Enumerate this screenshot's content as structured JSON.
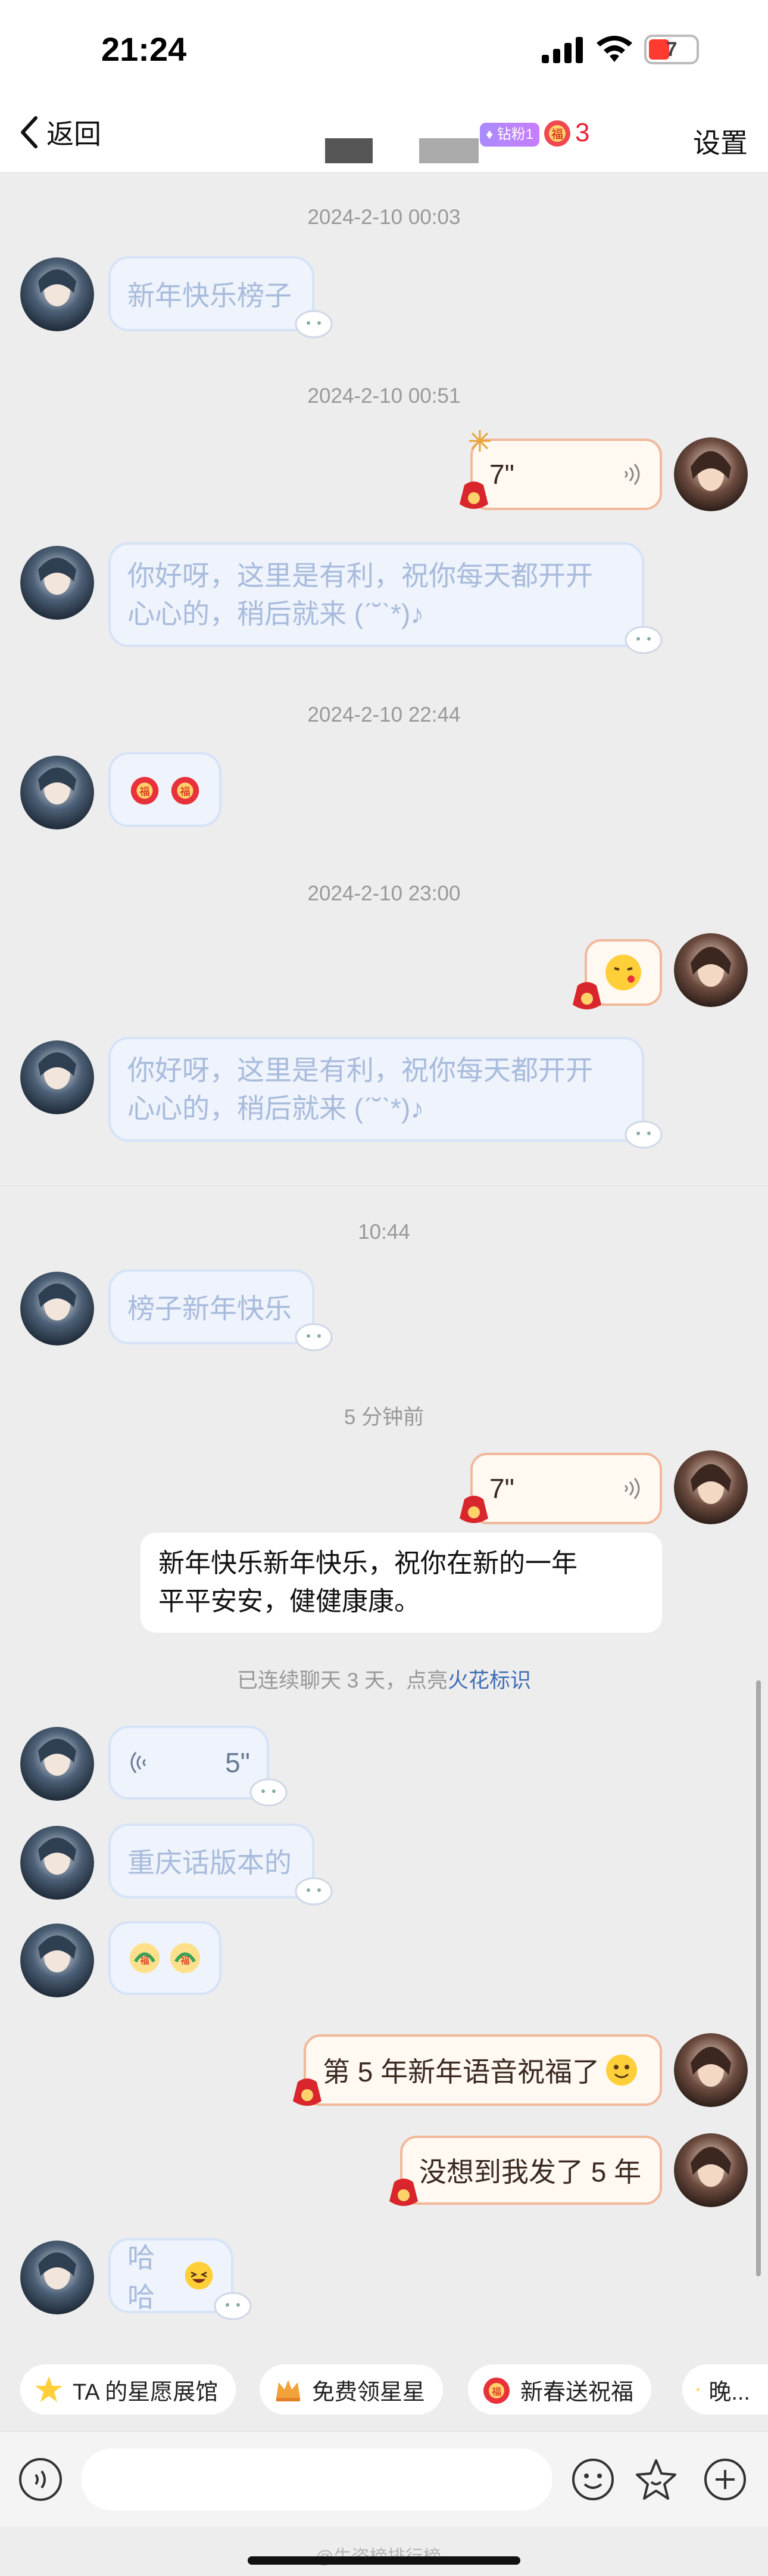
{
  "status_bar": {
    "time": "21:24",
    "battery_level": "7"
  },
  "nav": {
    "back_label": "返回",
    "badge_label": "钻粉1",
    "fire_count": "3",
    "settings_label": "设置"
  },
  "timestamps": {
    "t1": "2024-2-10 00:03",
    "t2": "2024-2-10 00:51",
    "t3": "2024-2-10 22:44",
    "t4": "2024-2-10 23:00",
    "t5": "10:44",
    "t6": "5 分钟前"
  },
  "messages": {
    "m1": "新年快乐榜子",
    "m2_voice": "7\"",
    "m3_line1": "你好呀，这里是有利，祝你每天都开开",
    "m3_line2": "心心的，稍后就来 (ˊ˘ˋ*)♪",
    "m6_line1": "你好呀，这里是有利，祝你每天都开开",
    "m6_line2": "心心的，稍后就来 (ˊ˘ˋ*)♪",
    "m7": "榜子新年快乐",
    "m8_voice": "7\"",
    "m8_transcript_line1": "新年快乐新年快乐，祝你在新的一年",
    "m8_transcript_line2": "平平安安，健健康康。",
    "m9_voice": "5\"",
    "m10": "重庆话版本的",
    "m12": "第 5 年新年语音祝福了",
    "m13": "没想到我发了 5 年",
    "m14": "哈哈"
  },
  "streak": {
    "prefix": "已连续聊天 3 天，点亮",
    "link": "火花标识"
  },
  "chips": [
    {
      "label": "TA 的星愿展馆",
      "icon": "star-icon"
    },
    {
      "label": "免费领星星",
      "icon": "crown-icon"
    },
    {
      "label": "新春送祝福",
      "icon": "fu-icon"
    },
    {
      "label": "晚...",
      "icon": "star-icon"
    }
  ],
  "watermark": "@生姿榜排行榜",
  "colors": {
    "fire": "#e8233a",
    "link": "#3f6fb6",
    "bubble_in": "#eef3fc",
    "bubble_out_border": "#f1b89b"
  }
}
